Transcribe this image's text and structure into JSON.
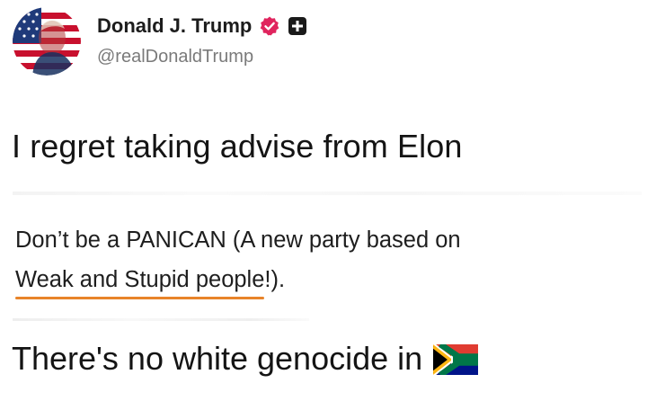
{
  "header": {
    "display_name": "Donald J. Trump",
    "handle": "@realDonaldTrump",
    "avatar_icon": "american-flag-portrait-avatar",
    "verified_icon": "verified-badge-icon",
    "verified_color": "#e0245e",
    "extra_icon": "plus-square-icon"
  },
  "captions": {
    "top": "I regret taking advise from Elon",
    "bottom": "There's no white genocide in"
  },
  "post": {
    "line1": "Don’t be a PANICAN (A new party based on",
    "line2_underlined": "Weak and Stupid people",
    "line2_rest": "!).",
    "underline_color": "#e8842a"
  },
  "flag": {
    "icon": "south-africa-flag-icon"
  }
}
